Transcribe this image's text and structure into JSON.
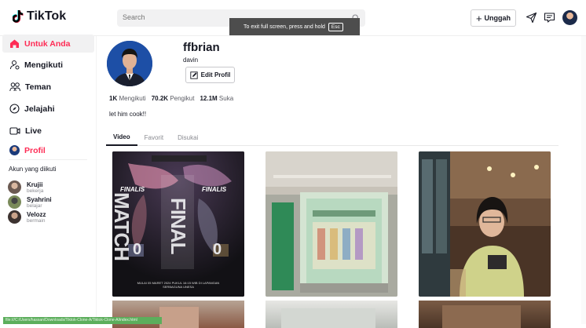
{
  "app": {
    "logo_text": "TikTok"
  },
  "header": {
    "search_placeholder": "Search",
    "upload_label": "Unggah",
    "toast_text": "To exit full screen, press and hold",
    "toast_key": "Esc"
  },
  "sidebar": {
    "items": [
      {
        "label": "Untuk Anda",
        "icon": "home-icon"
      },
      {
        "label": "Mengikuti",
        "icon": "following-icon"
      },
      {
        "label": "Teman",
        "icon": "friends-icon"
      },
      {
        "label": "Jelajahi",
        "icon": "compass-icon"
      },
      {
        "label": "Live",
        "icon": "live-icon"
      },
      {
        "label": "Profil",
        "icon": "profile-avatar-icon"
      }
    ],
    "following_title": "Akun yang diikuti",
    "following": [
      {
        "name": "Krujii",
        "sub": "bekerja"
      },
      {
        "name": "Syahrini",
        "sub": "belajar"
      },
      {
        "name": "Velozz",
        "sub": "bermain"
      }
    ]
  },
  "profile": {
    "username": "ffbrian",
    "nickname": "davin",
    "edit_label": "Edit Profil",
    "following_count": "1K",
    "following_label": "Mengikuti",
    "followers_count": "70.2K",
    "followers_label": "Pengikut",
    "likes_count": "12.1M",
    "likes_label": "Suka",
    "bio": "let him cook!!"
  },
  "tabs": [
    "Video",
    "Favorit",
    "Disukai"
  ],
  "video1": {
    "finalis_left": "FINALIS",
    "finalis_right": "FINALIS",
    "big_text": "FINAL MATCH",
    "score_left": "0",
    "score_right": "0",
    "footer_text": "MULAI 05 MARET 2024 PUKUL 16:15 WIB DI LAPANGAN SERBAGUNA UNESA"
  },
  "status_bar": "file:///C:/Users/hassan/Downloads/Tiktok-Clone-A/Tiktok-Clone-A/index.html",
  "colors": {
    "accent": "#fe2c55",
    "text": "#161823",
    "muted": "#8a8b91"
  }
}
